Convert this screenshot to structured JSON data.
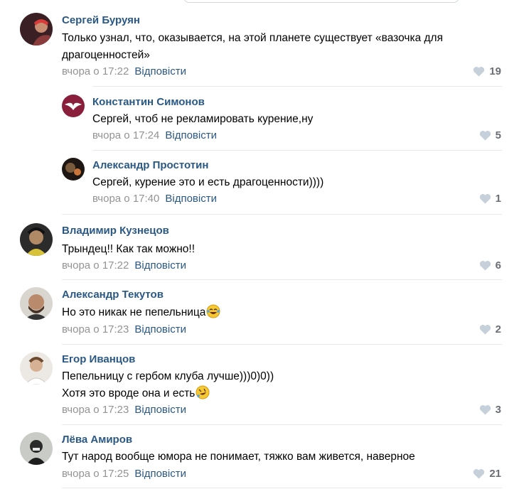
{
  "reply_label": "Відповісти",
  "comments": [
    {
      "author": "Сергей Буруян",
      "lines": [
        "Только узнал, что, оказывается, на этой планете существует «вазочка для",
        "драгоценностей»"
      ],
      "date": "вчора о 17:22",
      "likes": "19"
    },
    {
      "author": "Константин Симонов",
      "lines": [
        "Сергей, чтоб не рекламировать курение,ну"
      ],
      "date": "вчора о 17:24",
      "likes": "5"
    },
    {
      "author": "Александр Простотин",
      "lines": [
        "Сергей, курение это и есть драгоценности))))"
      ],
      "date": "вчора о 17:40",
      "likes": "1"
    },
    {
      "author": "Владимир Кузнецов",
      "lines": [
        "Трындец!! Как так можно!!"
      ],
      "date": "вчора о 17:22",
      "likes": "6"
    },
    {
      "author": "Александр Текутов",
      "lines": [
        "Но это никак не пепельница"
      ],
      "date": "вчора о 17:23",
      "likes": "2"
    },
    {
      "author": "Егор Иванцов",
      "lines": [
        "Пепельницу с гербом клуба лучше)))0)0))",
        "Хотя это вроде она и есть"
      ],
      "date": "вчора о 17:23",
      "likes": "3"
    },
    {
      "author": "Лёва Амиров",
      "lines": [
        "Тут народ вообще юмора не понимает, тяжко вам живется, наверное"
      ],
      "date": "вчора о 17:25",
      "likes": "21"
    }
  ],
  "colors": {
    "author": "#2a5885",
    "date": "#939393",
    "divider": "#e7e8ec",
    "heart": "#c5d0db"
  }
}
